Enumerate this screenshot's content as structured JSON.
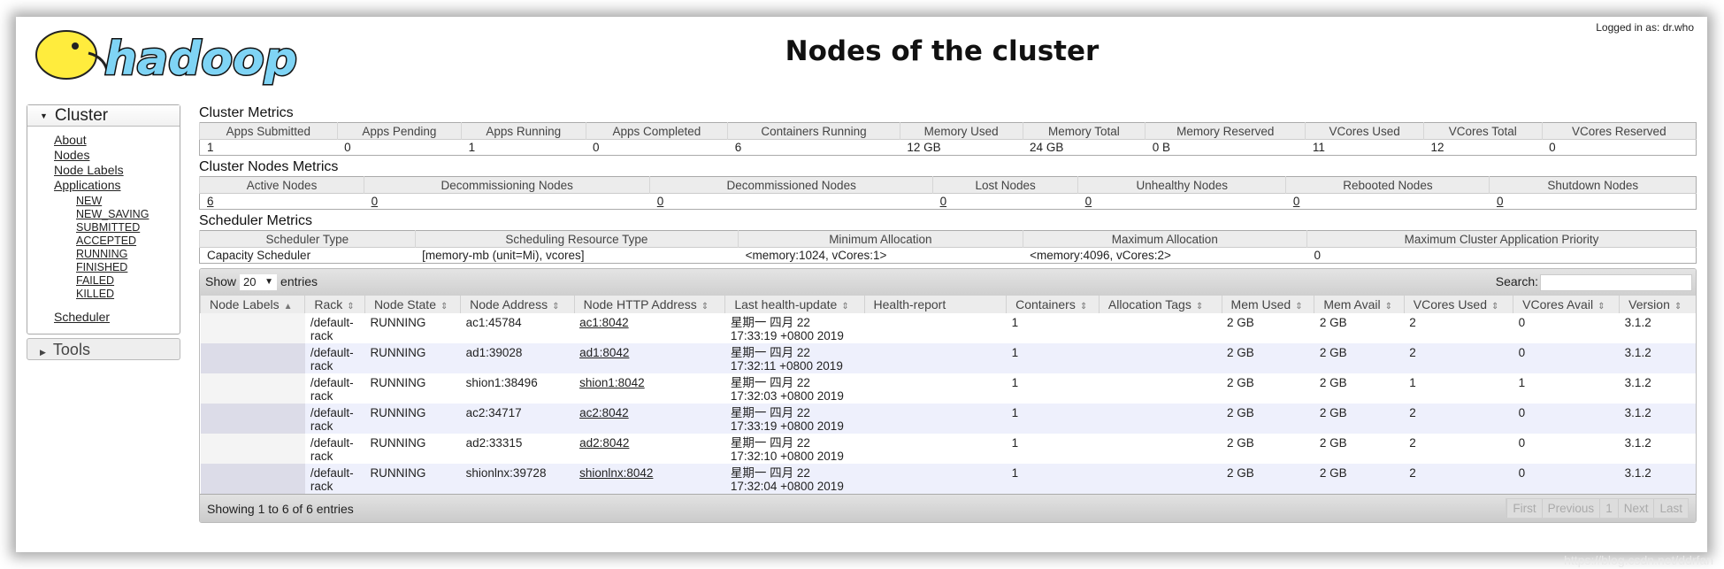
{
  "header": {
    "logo_text": "hadoop",
    "title": "Nodes of the cluster",
    "logged_in": "Logged in as: dr.who"
  },
  "sidebar": {
    "cluster_label": "Cluster",
    "links": [
      "About",
      "Nodes",
      "Node Labels",
      "Applications"
    ],
    "app_states": [
      "NEW",
      "NEW_SAVING",
      "SUBMITTED",
      "ACCEPTED",
      "RUNNING",
      "FINISHED",
      "FAILED",
      "KILLED"
    ],
    "scheduler": "Scheduler",
    "tools_label": "Tools"
  },
  "cluster_metrics": {
    "heading": "Cluster Metrics",
    "headers": [
      "Apps Submitted",
      "Apps Pending",
      "Apps Running",
      "Apps Completed",
      "Containers Running",
      "Memory Used",
      "Memory Total",
      "Memory Reserved",
      "VCores Used",
      "VCores Total",
      "VCores Reserved"
    ],
    "values": [
      "1",
      "0",
      "1",
      "0",
      "6",
      "12 GB",
      "24 GB",
      "0 B",
      "11",
      "12",
      "0"
    ]
  },
  "nodes_metrics": {
    "heading": "Cluster Nodes Metrics",
    "headers": [
      "Active Nodes",
      "Decommissioning Nodes",
      "Decommissioned Nodes",
      "Lost Nodes",
      "Unhealthy Nodes",
      "Rebooted Nodes",
      "Shutdown Nodes"
    ],
    "values": [
      "6",
      "0",
      "0",
      "0",
      "0",
      "0",
      "0"
    ]
  },
  "scheduler_metrics": {
    "heading": "Scheduler Metrics",
    "headers": [
      "Scheduler Type",
      "Scheduling Resource Type",
      "Minimum Allocation",
      "Maximum Allocation",
      "Maximum Cluster Application Priority"
    ],
    "values": [
      "Capacity Scheduler",
      "[memory-mb (unit=Mi), vcores]",
      "<memory:1024, vCores:1>",
      "<memory:4096, vCores:2>",
      "0"
    ]
  },
  "nodes_table": {
    "show_label": "Show",
    "page_size": "20",
    "entries_label": "entries",
    "search_label": "Search:",
    "search_value": "",
    "columns": [
      "Node Labels",
      "Rack",
      "Node State",
      "Node Address",
      "Node HTTP Address",
      "Last health-update",
      "Health-report",
      "Containers",
      "Allocation Tags",
      "Mem Used",
      "Mem Avail",
      "VCores Used",
      "VCores Avail",
      "Version"
    ],
    "rows": [
      [
        "",
        "/default-rack",
        "RUNNING",
        "ac1:45784",
        "ac1:8042",
        "星期一 四月 22 17:33:19 +0800 2019",
        "",
        "1",
        "",
        "2 GB",
        "2 GB",
        "2",
        "0",
        "3.1.2"
      ],
      [
        "",
        "/default-rack",
        "RUNNING",
        "ad1:39028",
        "ad1:8042",
        "星期一 四月 22 17:32:11 +0800 2019",
        "",
        "1",
        "",
        "2 GB",
        "2 GB",
        "2",
        "0",
        "3.1.2"
      ],
      [
        "",
        "/default-rack",
        "RUNNING",
        "shion1:38496",
        "shion1:8042",
        "星期一 四月 22 17:32:03 +0800 2019",
        "",
        "1",
        "",
        "2 GB",
        "2 GB",
        "1",
        "1",
        "3.1.2"
      ],
      [
        "",
        "/default-rack",
        "RUNNING",
        "ac2:34717",
        "ac2:8042",
        "星期一 四月 22 17:33:19 +0800 2019",
        "",
        "1",
        "",
        "2 GB",
        "2 GB",
        "2",
        "0",
        "3.1.2"
      ],
      [
        "",
        "/default-rack",
        "RUNNING",
        "ad2:33315",
        "ad2:8042",
        "星期一 四月 22 17:32:10 +0800 2019",
        "",
        "1",
        "",
        "2 GB",
        "2 GB",
        "2",
        "0",
        "3.1.2"
      ],
      [
        "",
        "/default-rack",
        "RUNNING",
        "shionlnx:39728",
        "shionlnx:8042",
        "星期一 四月 22 17:32:04 +0800 2019",
        "",
        "1",
        "",
        "2 GB",
        "2 GB",
        "2",
        "0",
        "3.1.2"
      ]
    ],
    "info": "Showing 1 to 6 of 6 entries",
    "pagination": [
      "First",
      "Previous",
      "1",
      "Next",
      "Last"
    ]
  },
  "watermark": "https://blog.csdn.net/ddrfan"
}
